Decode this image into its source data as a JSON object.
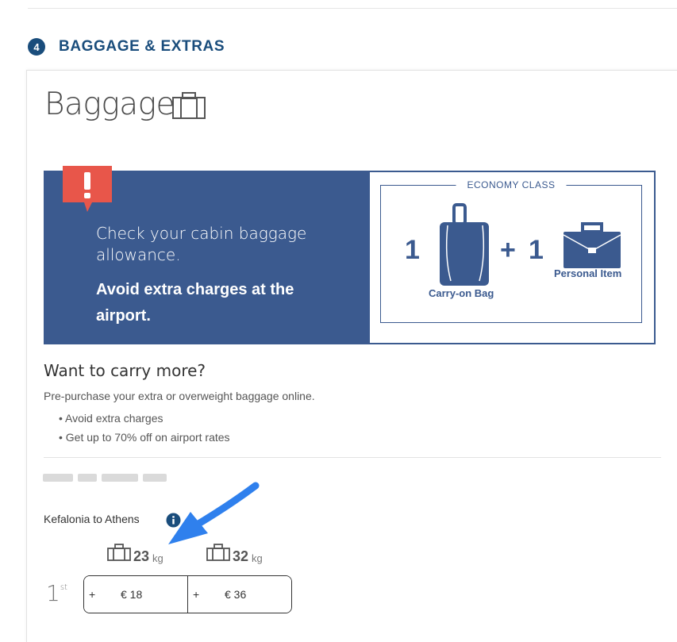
{
  "step": {
    "number": "4",
    "title": "BAGGAGE & EXTRAS"
  },
  "section": {
    "title": "Baggage",
    "title_icon": "suitcase-icon"
  },
  "banner": {
    "alert_icon": "exclamation-icon",
    "message": "Check your cabin baggage allowance.",
    "emphasis": "Avoid extra charges at the airport.",
    "bg_color": "#3b5a8f",
    "alert_color": "#e8564a"
  },
  "allowance": {
    "class_label": "ECONOMY CLASS",
    "carryon_count": "1",
    "plus": "+",
    "carryon_label": "Carry-on Bag",
    "personal_count": "1",
    "personal_label": "Personal Item"
  },
  "extras": {
    "heading": "Want to carry more?",
    "intro": "Pre-purchase your extra or overweight baggage online.",
    "benefits": [
      "Avoid extra charges",
      "Get up to 70% off on airport rates"
    ]
  },
  "passenger": {
    "route": "Kefalonia to Athens",
    "ordinal_number": "1",
    "ordinal_suffix": "st",
    "options": [
      {
        "weight": "23",
        "unit": "kg",
        "plus": "+",
        "price": "€ 18"
      },
      {
        "weight": "32",
        "unit": "kg",
        "plus": "+",
        "price": "€ 36"
      }
    ]
  },
  "annotation": {
    "arrow_color": "#2f80ed"
  }
}
